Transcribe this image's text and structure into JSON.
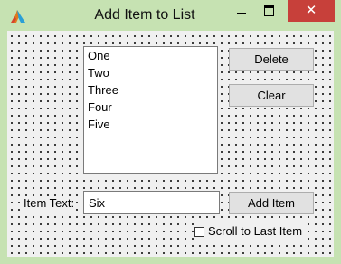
{
  "window": {
    "title": "Add Item to List",
    "minimize_icon": "minimize-icon",
    "maximize_icon": "maximize-icon",
    "close_icon": "close-icon",
    "close_glyph": "✕",
    "app_icon": "app-logo-icon"
  },
  "list": {
    "items": [
      "One",
      "Two",
      "Three",
      "Four",
      "Five"
    ]
  },
  "buttons": {
    "delete": "Delete",
    "clear": "Clear",
    "add_item": "Add Item"
  },
  "input": {
    "label": "Item Text:",
    "value": "Six"
  },
  "checkbox": {
    "label": "Scroll to Last Item",
    "checked": false
  },
  "colors": {
    "titlebar": "#c6e2b2",
    "close_button": "#c7403a",
    "client_background": "#f0f0f0",
    "button_background": "#e1e1e1"
  }
}
